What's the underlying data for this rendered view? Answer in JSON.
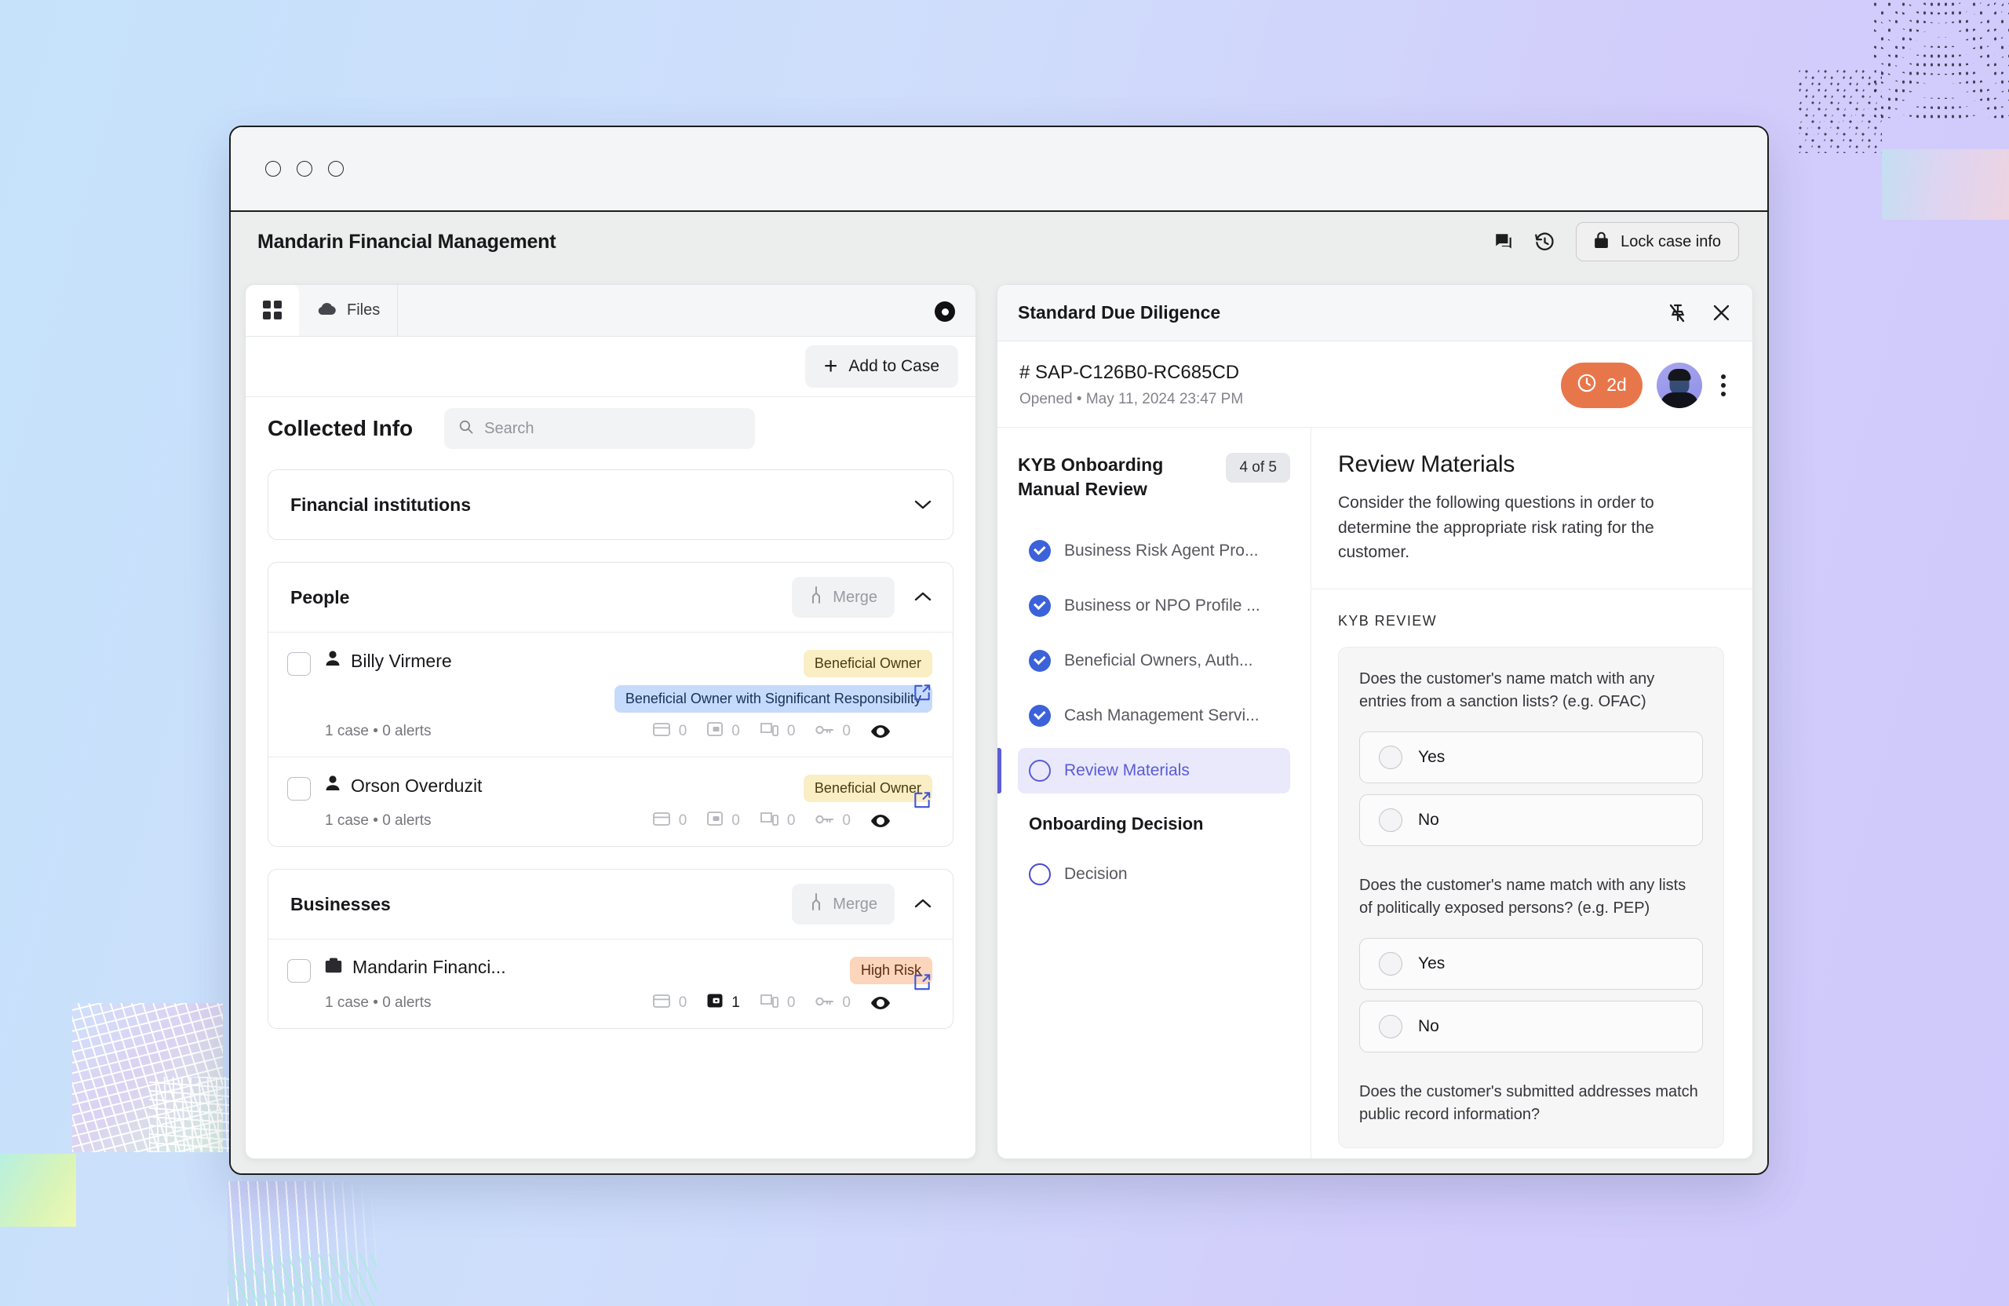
{
  "window": {
    "app_title": "Mandarin Financial Management",
    "traffic_dots": [
      "close",
      "minimize",
      "maximize"
    ]
  },
  "appbar": {
    "comments_icon": "comment-icon",
    "history_icon": "history-icon",
    "lock_label": "Lock case info",
    "lock_icon": "lock-icon"
  },
  "left_panel": {
    "tabs": [
      {
        "label": "",
        "icon": "grid-icon",
        "active": true
      },
      {
        "label": "Files",
        "icon": "cloud-icon",
        "active": false
      }
    ],
    "tabbar_action_icon": "record-circle-icon",
    "add_to_case_label": "Add to Case",
    "collected_title": "Collected Info",
    "search": {
      "placeholder": "Search",
      "value": "",
      "icon": "search-icon"
    },
    "sections": [
      {
        "title": "Financial institutions",
        "collapsed": true,
        "chevron": "chevron-down-icon",
        "entities": []
      },
      {
        "title": "People",
        "collapsed": false,
        "chevron": "chevron-up-icon",
        "merge_label": "Merge",
        "entities": [
          {
            "name": "Billy Virmere",
            "icon": "person-icon",
            "tags": [
              {
                "text": "Beneficial Owner",
                "style": "owner"
              },
              {
                "text": "Beneficial Owner with Significant Responsibility",
                "style": "bosr"
              }
            ],
            "meta": "1 case • 0 alerts",
            "counts": [
              {
                "icon": "card-icon",
                "value": "0",
                "highlight": false
              },
              {
                "icon": "wallet-icon",
                "value": "0",
                "highlight": false
              },
              {
                "icon": "devices-icon",
                "value": "0",
                "highlight": false
              },
              {
                "icon": "key-icon",
                "value": "0",
                "highlight": false
              }
            ],
            "eye_icon": "eye-icon",
            "open_icon": "external-link-icon"
          },
          {
            "name": "Orson Overduzit",
            "icon": "person-icon",
            "tags": [
              {
                "text": "Beneficial Owner",
                "style": "owner"
              }
            ],
            "meta": "1 case • 0 alerts",
            "counts": [
              {
                "icon": "card-icon",
                "value": "0",
                "highlight": false
              },
              {
                "icon": "wallet-icon",
                "value": "0",
                "highlight": false
              },
              {
                "icon": "devices-icon",
                "value": "0",
                "highlight": false
              },
              {
                "icon": "key-icon",
                "value": "0",
                "highlight": false
              }
            ],
            "eye_icon": "eye-icon",
            "open_icon": "external-link-icon"
          }
        ]
      },
      {
        "title": "Businesses",
        "collapsed": false,
        "chevron": "chevron-up-icon",
        "merge_label": "Merge",
        "entities": [
          {
            "name": "Mandarin Financi...",
            "icon": "briefcase-icon",
            "tags": [
              {
                "text": "High Risk",
                "style": "risk"
              }
            ],
            "meta": "1 case • 0 alerts",
            "counts": [
              {
                "icon": "card-icon",
                "value": "0",
                "highlight": false
              },
              {
                "icon": "wallet-icon",
                "value": "1",
                "highlight": true
              },
              {
                "icon": "devices-icon",
                "value": "0",
                "highlight": false
              },
              {
                "icon": "key-icon",
                "value": "0",
                "highlight": false
              }
            ],
            "eye_icon": "eye-icon",
            "open_icon": "external-link-icon"
          }
        ]
      }
    ]
  },
  "right_panel": {
    "title": "Standard Due Diligence",
    "pin_icon": "unpin-icon",
    "close_icon": "close-icon",
    "case_id": "# SAP-C126B0-RC685CD",
    "case_opened": "Opened • May 11, 2024 23:47 PM",
    "sla_badge": "2d",
    "sla_icon": "clock-icon",
    "sla_color": "#e8764b",
    "avatar": "user-avatar",
    "menu_icon": "kebab-menu-icon",
    "checklist": {
      "title": "KYB Onboarding Manual Review",
      "progress_badge": "4 of 5",
      "items": [
        {
          "label": "Business Risk Agent Pro...",
          "state": "done"
        },
        {
          "label": "Business or NPO Profile ...",
          "state": "done"
        },
        {
          "label": "Beneficial Owners, Auth...",
          "state": "done"
        },
        {
          "label": "Cash Management Servi...",
          "state": "done"
        },
        {
          "label": "Review Materials",
          "state": "active"
        }
      ],
      "section_label": "Onboarding Decision",
      "decision_items": [
        {
          "label": "Decision",
          "state": "open"
        }
      ]
    },
    "content": {
      "heading": "Review Materials",
      "description": "Consider the following questions in order to determine the appropriate risk rating for the customer.",
      "section_label": "KYB REVIEW",
      "questions": [
        {
          "text": "Does the customer's name match with any entries from a sanction lists? (e.g. OFAC)",
          "options": [
            {
              "label": "Yes",
              "selected": false
            },
            {
              "label": "No",
              "selected": false
            }
          ]
        },
        {
          "text": "Does the customer's name match with any lists of politically exposed persons? (e.g. PEP)",
          "options": [
            {
              "label": "Yes",
              "selected": false
            },
            {
              "label": "No",
              "selected": false
            }
          ]
        },
        {
          "text": "Does the customer's submitted addresses match public record information?",
          "options": []
        }
      ]
    }
  },
  "theme": {
    "accent": "#5b5bd6",
    "check_blue": "#3b62d9",
    "sla_orange": "#e8764b",
    "link_blue": "#3b55d9"
  }
}
